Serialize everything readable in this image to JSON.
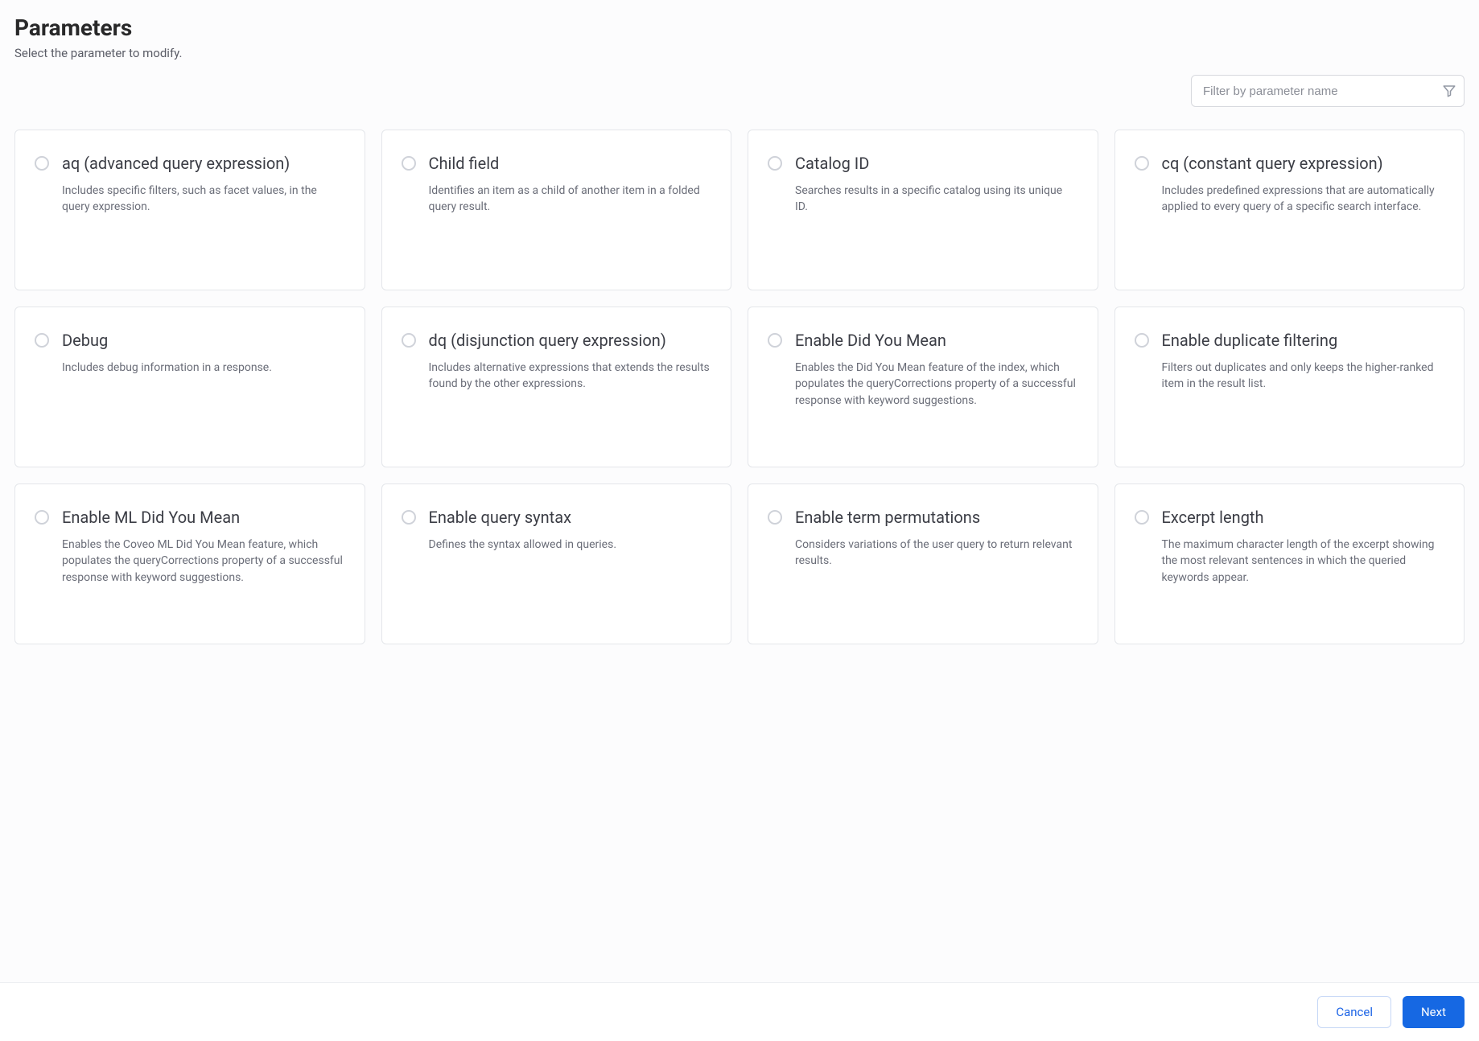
{
  "header": {
    "title": "Parameters",
    "subtitle": "Select the parameter to modify."
  },
  "filter": {
    "placeholder": "Filter by parameter name",
    "value": ""
  },
  "parameters": [
    {
      "id": "aq",
      "title": "aq (advanced query expression)",
      "description": "Includes specific filters, such as facet values, in the query expression."
    },
    {
      "id": "child-field",
      "title": "Child field",
      "description": "Identifies an item as a child of another item in a folded query result."
    },
    {
      "id": "catalog-id",
      "title": "Catalog ID",
      "description": "Searches results in a specific catalog using its unique ID."
    },
    {
      "id": "cq",
      "title": "cq (constant query expression)",
      "description": "Includes predefined expressions that are automatically applied to every query of a specific search interface."
    },
    {
      "id": "debug",
      "title": "Debug",
      "description": "Includes debug information in a response."
    },
    {
      "id": "dq",
      "title": "dq (disjunction query expression)",
      "description": "Includes alternative expressions that extends the results found by the other expressions."
    },
    {
      "id": "enable-dym",
      "title": "Enable Did You Mean",
      "description": "Enables the Did You Mean feature of the index, which populates the queryCorrections property of a successful response with keyword suggestions."
    },
    {
      "id": "enable-dup",
      "title": "Enable duplicate filtering",
      "description": "Filters out duplicates and only keeps the higher-ranked item in the result list."
    },
    {
      "id": "enable-ml-dym",
      "title": "Enable ML Did You Mean",
      "description": "Enables the Coveo ML Did You Mean feature, which populates the queryCorrections property of a successful response with keyword suggestions."
    },
    {
      "id": "enable-query-syntax",
      "title": "Enable query syntax",
      "description": "Defines the syntax allowed in queries."
    },
    {
      "id": "enable-term-perm",
      "title": "Enable term permutations",
      "description": "Considers variations of the user query to return relevant results."
    },
    {
      "id": "excerpt-length",
      "title": "Excerpt length",
      "description": "The maximum character length of the excerpt showing the most relevant sentences in which the queried keywords appear."
    }
  ],
  "footer": {
    "cancel_label": "Cancel",
    "next_label": "Next"
  }
}
